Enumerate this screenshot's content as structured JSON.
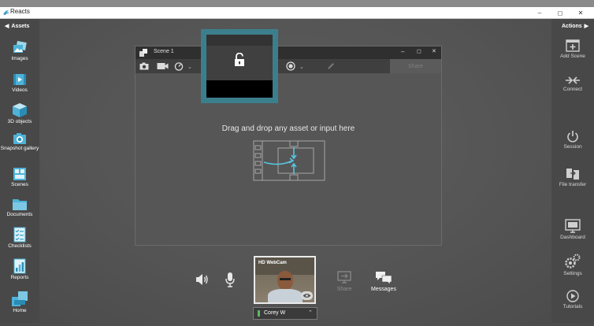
{
  "window": {
    "title": "Reacts",
    "minimize": "–",
    "maximize": "◻",
    "close": "✕"
  },
  "left_panel": {
    "header": "Assets",
    "items": [
      {
        "label": "Images",
        "icon": "images-icon"
      },
      {
        "label": "Videos",
        "icon": "videos-icon"
      },
      {
        "label": "3D objects",
        "icon": "3d-objects-icon"
      },
      {
        "label": "Snapshot gallery",
        "icon": "snapshot-gallery-icon"
      },
      {
        "label": "Scenes",
        "icon": "scenes-icon"
      },
      {
        "label": "Documents",
        "icon": "documents-icon"
      },
      {
        "label": "Checklists",
        "icon": "checklists-icon"
      },
      {
        "label": "Reports",
        "icon": "reports-icon"
      },
      {
        "label": "Home",
        "icon": "home-icon"
      }
    ]
  },
  "right_panel": {
    "header": "Actions",
    "items": [
      {
        "label": "Add Scene",
        "icon": "add-scene-icon"
      },
      {
        "label": "Connect",
        "icon": "connect-icon"
      },
      {
        "label": "Session",
        "icon": "power-icon"
      },
      {
        "label": "File transfer",
        "icon": "file-transfer-icon"
      },
      {
        "label": "Dashboard",
        "icon": "dashboard-icon"
      },
      {
        "label": "Settings",
        "icon": "settings-icon"
      },
      {
        "label": "Tutorials",
        "icon": "tutorials-icon"
      }
    ]
  },
  "scene": {
    "title": "Scene 1",
    "drop_text": "Drag and drop any asset or input here",
    "share_label": "Share"
  },
  "bottom": {
    "webcam_label": "HD WebCam",
    "user_name": "Corey W",
    "share_label": "Share",
    "messages_label": "Messages"
  },
  "colors": {
    "accent": "#3c7f8c",
    "cyan": "#56c4e0",
    "green": "#5fb85f"
  }
}
